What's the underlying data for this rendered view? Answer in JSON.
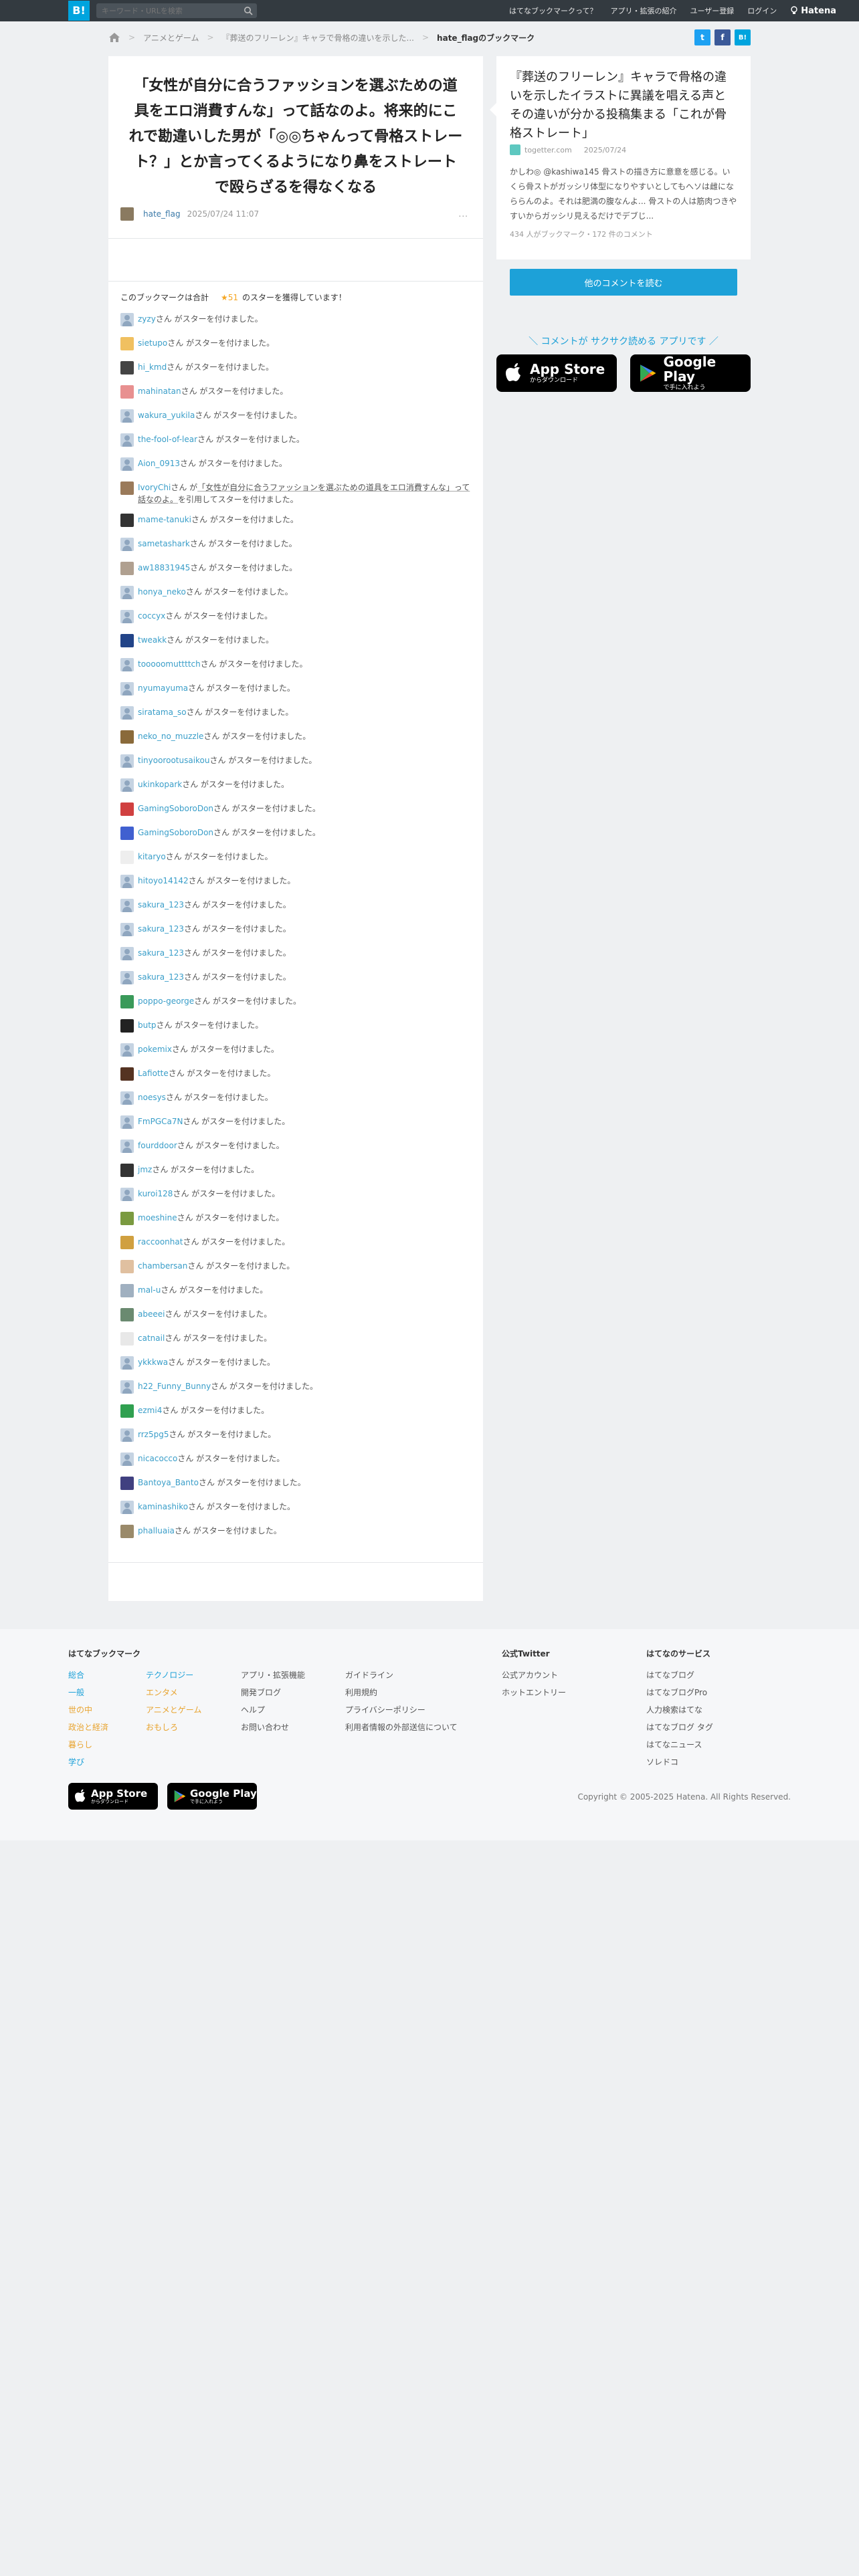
{
  "header": {
    "logo": "B!",
    "search_placeholder": "キーワード・URLを検索",
    "nav": [
      "はてなブックマークって？",
      "アプリ・拡張の紹介",
      "ユーザー登録",
      "ログイン"
    ],
    "brand": "Hatena"
  },
  "breadcrumb": {
    "items": [
      "アニメとゲーム",
      "『葬送のフリーレン』キャラで骨格の違いを示した..."
    ],
    "current": "hate_flagのブックマーク"
  },
  "entry": {
    "title": "「女性が自分に合うファッションを選ぶための道具をエロ消費すんな」って話なのよ。将来的にこれで勘違いした男が「◎◎ちゃんって骨格ストレート？」とか言ってくるようになり鼻をストレートで殴らざるを得なくなる",
    "user": "hate_flag",
    "date": "2025/07/24 11:07",
    "more": "...",
    "star_summary_prefix": "このブックマークは合計",
    "star_count": "★51",
    "star_summary_suffix": "のスターを獲得しています！"
  },
  "stars": [
    {
      "name": "zyzy",
      "text": "さん がスターを付けました。",
      "avatar": "#c5d3e2"
    },
    {
      "name": "sietupo",
      "text": "さん がスターを付けました。",
      "avatar": "#f0c060"
    },
    {
      "name": "hi_kmd",
      "text": "さん がスターを付けました。",
      "avatar": "#444"
    },
    {
      "name": "mahinatan",
      "text": "さん がスターを付けました。",
      "avatar": "#e89090"
    },
    {
      "name": "wakura_yukila",
      "text": "さん がスターを付けました。",
      "avatar": "#c5d3e2"
    },
    {
      "name": "the-fool-of-lear",
      "text": "さん がスターを付けました。",
      "avatar": "#c5d3e2"
    },
    {
      "name": "Aion_0913",
      "text": "さん がスターを付けました。",
      "avatar": "#c5d3e2"
    },
    {
      "name": "IvoryChi",
      "text": "さん が",
      "quote": "「女性が自分に合うファッションを選ぶための道具をエロ消費すんな」って話なのよ。",
      "text2": "を引用してスターを付けました。",
      "avatar": "#9a7a5a"
    },
    {
      "name": "mame-tanuki",
      "text": "さん がスターを付けました。",
      "avatar": "#333"
    },
    {
      "name": "sametashark",
      "text": "さん がスターを付けました。",
      "avatar": "#c5d3e2"
    },
    {
      "name": "aw18831945",
      "text": "さん がスターを付けました。",
      "avatar": "#b0a090"
    },
    {
      "name": "honya_neko",
      "text": "さん がスターを付けました。",
      "avatar": "#c5d3e2"
    },
    {
      "name": "coccyx",
      "text": "さん がスターを付けました。",
      "avatar": "#c5d3e2"
    },
    {
      "name": "tweakk",
      "text": "さん がスターを付けました。",
      "avatar": "#224488"
    },
    {
      "name": "tooooomuttttch",
      "text": "さん がスターを付けました。",
      "avatar": "#c5d3e2"
    },
    {
      "name": "nyumayuma",
      "text": "さん がスターを付けました。",
      "avatar": "#c5d3e2"
    },
    {
      "name": "siratama_so",
      "text": "さん がスターを付けました。",
      "avatar": "#c5d3e2"
    },
    {
      "name": "neko_no_muzzle",
      "text": "さん がスターを付けました。",
      "avatar": "#8a6a3a"
    },
    {
      "name": "tinyoorootusaikou",
      "text": "さん がスターを付けました。",
      "avatar": "#c5d3e2"
    },
    {
      "name": "ukinkopark",
      "text": "さん がスターを付けました。",
      "avatar": "#c5d3e2"
    },
    {
      "name": "GamingSoboroDon",
      "text": "さん がスターを付けました。",
      "avatar": "#d04040"
    },
    {
      "name": "GamingSoboroDon",
      "text": "さん がスターを付けました。",
      "avatar": "#4060d0"
    },
    {
      "name": "kitaryo",
      "text": "さん がスターを付けました。",
      "avatar": "#eee"
    },
    {
      "name": "hitoyo14142",
      "text": "さん がスターを付けました。",
      "avatar": "#c5d3e2"
    },
    {
      "name": "sakura_123",
      "text": "さん がスターを付けました。",
      "avatar": "#c5d3e2"
    },
    {
      "name": "sakura_123",
      "text": "さん がスターを付けました。",
      "avatar": "#c5d3e2"
    },
    {
      "name": "sakura_123",
      "text": "さん がスターを付けました。",
      "avatar": "#c5d3e2"
    },
    {
      "name": "sakura_123",
      "text": "さん がスターを付けました。",
      "avatar": "#c5d3e2"
    },
    {
      "name": "poppo-george",
      "text": "さん がスターを付けました。",
      "avatar": "#3a9a5a"
    },
    {
      "name": "butp",
      "text": "さん がスターを付けました。",
      "avatar": "#222"
    },
    {
      "name": "pokemix",
      "text": "さん がスターを付けました。",
      "avatar": "#c5d3e2"
    },
    {
      "name": "Lafiotte",
      "text": "さん がスターを付けました。",
      "avatar": "#553322"
    },
    {
      "name": "noesys",
      "text": "さん がスターを付けました。",
      "avatar": "#c5d3e2"
    },
    {
      "name": "FmPGCa7N",
      "text": "さん がスターを付けました。",
      "avatar": "#c5d3e2"
    },
    {
      "name": "fourddoor",
      "text": "さん がスターを付けました。",
      "avatar": "#c5d3e2"
    },
    {
      "name": "jmz",
      "text": "さん がスターを付けました。",
      "avatar": "#333"
    },
    {
      "name": "kuroi128",
      "text": "さん がスターを付けました。",
      "avatar": "#c5d3e2"
    },
    {
      "name": "moeshine",
      "text": "さん がスターを付けました。",
      "avatar": "#7a9a40"
    },
    {
      "name": "raccoonhat",
      "text": "さん がスターを付けました。",
      "avatar": "#d0a040"
    },
    {
      "name": "chambersan",
      "text": "さん がスターを付けました。",
      "avatar": "#e0c0a0"
    },
    {
      "name": "mal-u",
      "text": "さん がスターを付けました。",
      "avatar": "#a0b0c0"
    },
    {
      "name": "abeeei",
      "text": "さん がスターを付けました。",
      "avatar": "#6a8a70"
    },
    {
      "name": "catnail",
      "text": "さん がスターを付けました。",
      "avatar": "#e8e8e8"
    },
    {
      "name": "ykkkwa",
      "text": "さん がスターを付けました。",
      "avatar": "#c5d3e2"
    },
    {
      "name": "h22_Funny_Bunny",
      "text": "さん がスターを付けました。",
      "avatar": "#c5d3e2"
    },
    {
      "name": "ezmi4",
      "text": "さん がスターを付けました。",
      "avatar": "#30a050"
    },
    {
      "name": "rrz5pg5",
      "text": "さん がスターを付けました。",
      "avatar": "#c5d3e2"
    },
    {
      "name": "nicacocco",
      "text": "さん がスターを付けました。",
      "avatar": "#c5d3e2"
    },
    {
      "name": "Bantoya_Banto",
      "text": "さん がスターを付けました。",
      "avatar": "#404080"
    },
    {
      "name": "kaminashiko",
      "text": "さん がスターを付けました。",
      "avatar": "#c5d3e2"
    },
    {
      "name": "phalluaia",
      "text": "さん がスターを付けました。",
      "avatar": "#9a8a6a"
    }
  ],
  "side": {
    "title": "『葬送のフリーレン』キャラで骨格の違いを示したイラストに異議を唱える声とその違いが分かる投稿集まる「これが骨格ストレート」",
    "source": "togetter.com",
    "date": "2025/07/24",
    "excerpt": "かしわ◎ @kashiwa145 骨ストの描き方に意意を感じる。いくら骨ストがガッシリ体型になりやすいとしてもへソは雌になららんのよ。それは肥満の腹なんよ... 骨ストの人は筋肉つきやすいからガッシリ見えるだけでデブじ...",
    "counts": "434 人がブックマーク・172 件のコメント",
    "button": "他のコメントを読む",
    "promo": "＼ コメントが サクサク読める アプリです ／",
    "appstore_big": "App Store",
    "appstore_small": "からダウンロード",
    "googleplay_big": "Google Play",
    "googleplay_small": "で手に入れよう"
  },
  "footer": {
    "heading_main": "はてなブックマーク",
    "categories_blue": [
      "総合",
      "一般",
      "テクノロジー",
      "エンタメ"
    ],
    "col1": [
      "総合",
      "一般",
      "世の中",
      "政治と経済",
      "暮らし",
      "学び"
    ],
    "col2": [
      "テクノロジー",
      "エンタメ",
      "アニメとゲーム",
      "おもしろ"
    ],
    "col3": [
      "アプリ・拡張機能",
      "開発ブログ",
      "ヘルプ",
      "お問い合わせ"
    ],
    "col4": [
      "ガイドライン",
      "利用規約",
      "プライバシーポリシー",
      "利用者情報の外部送信について"
    ],
    "heading_twitter": "公式Twitter",
    "twitter": [
      "公式アカウント",
      "ホットエントリー"
    ],
    "heading_services": "はてなのサービス",
    "services": [
      "はてなブログ",
      "はてなブログPro",
      "人力検索はてな",
      "はてなブログ タグ",
      "はてなニュース",
      "ソレドコ"
    ],
    "appstore_big": "App Store",
    "appstore_small": "からダウンロード",
    "googleplay_big": "Google Play",
    "googleplay_small": "で手に入れよう",
    "copyright": "Copyright © 2005-2025 Hatena. All Rights Reserved."
  }
}
